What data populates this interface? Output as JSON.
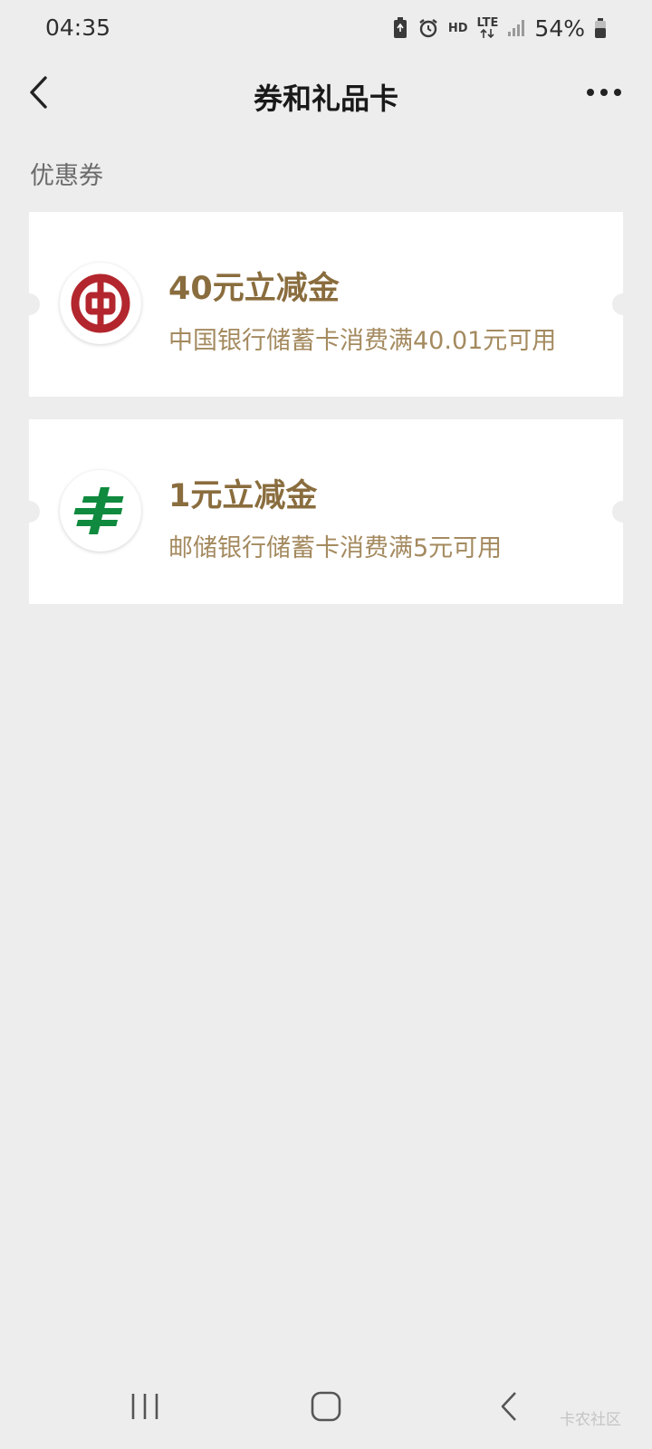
{
  "status_bar": {
    "time": "04:35",
    "hd_label": "HD",
    "network_label": "LTE",
    "battery_percent": "54%",
    "icons": [
      "battery-saver-icon",
      "alarm-icon",
      "hd-icon",
      "lte-icon",
      "signal-icon",
      "battery-icon"
    ]
  },
  "nav": {
    "title": "券和礼品卡",
    "back_icon": "chevron-left-icon",
    "more_icon": "more-dots-icon"
  },
  "section": {
    "label": "优惠券"
  },
  "coupons": [
    {
      "title": "40元立减金",
      "description": "中国银行储蓄卡消费满40.01元可用",
      "logo": "bank-of-china-logo"
    },
    {
      "title": "1元立减金",
      "description": "邮储银行储蓄卡消费满5元可用",
      "logo": "postal-savings-bank-logo"
    }
  ],
  "system_nav": {
    "recent_icon": "recent-apps-icon",
    "home_icon": "home-icon",
    "back_icon": "back-icon"
  },
  "watermark": "卡农社区",
  "colors": {
    "background": "#ededed",
    "coupon_title": "#8a6d3e",
    "coupon_desc": "#a48a5f",
    "boc_red": "#b3262d",
    "psbc_green": "#0f8a3e"
  }
}
